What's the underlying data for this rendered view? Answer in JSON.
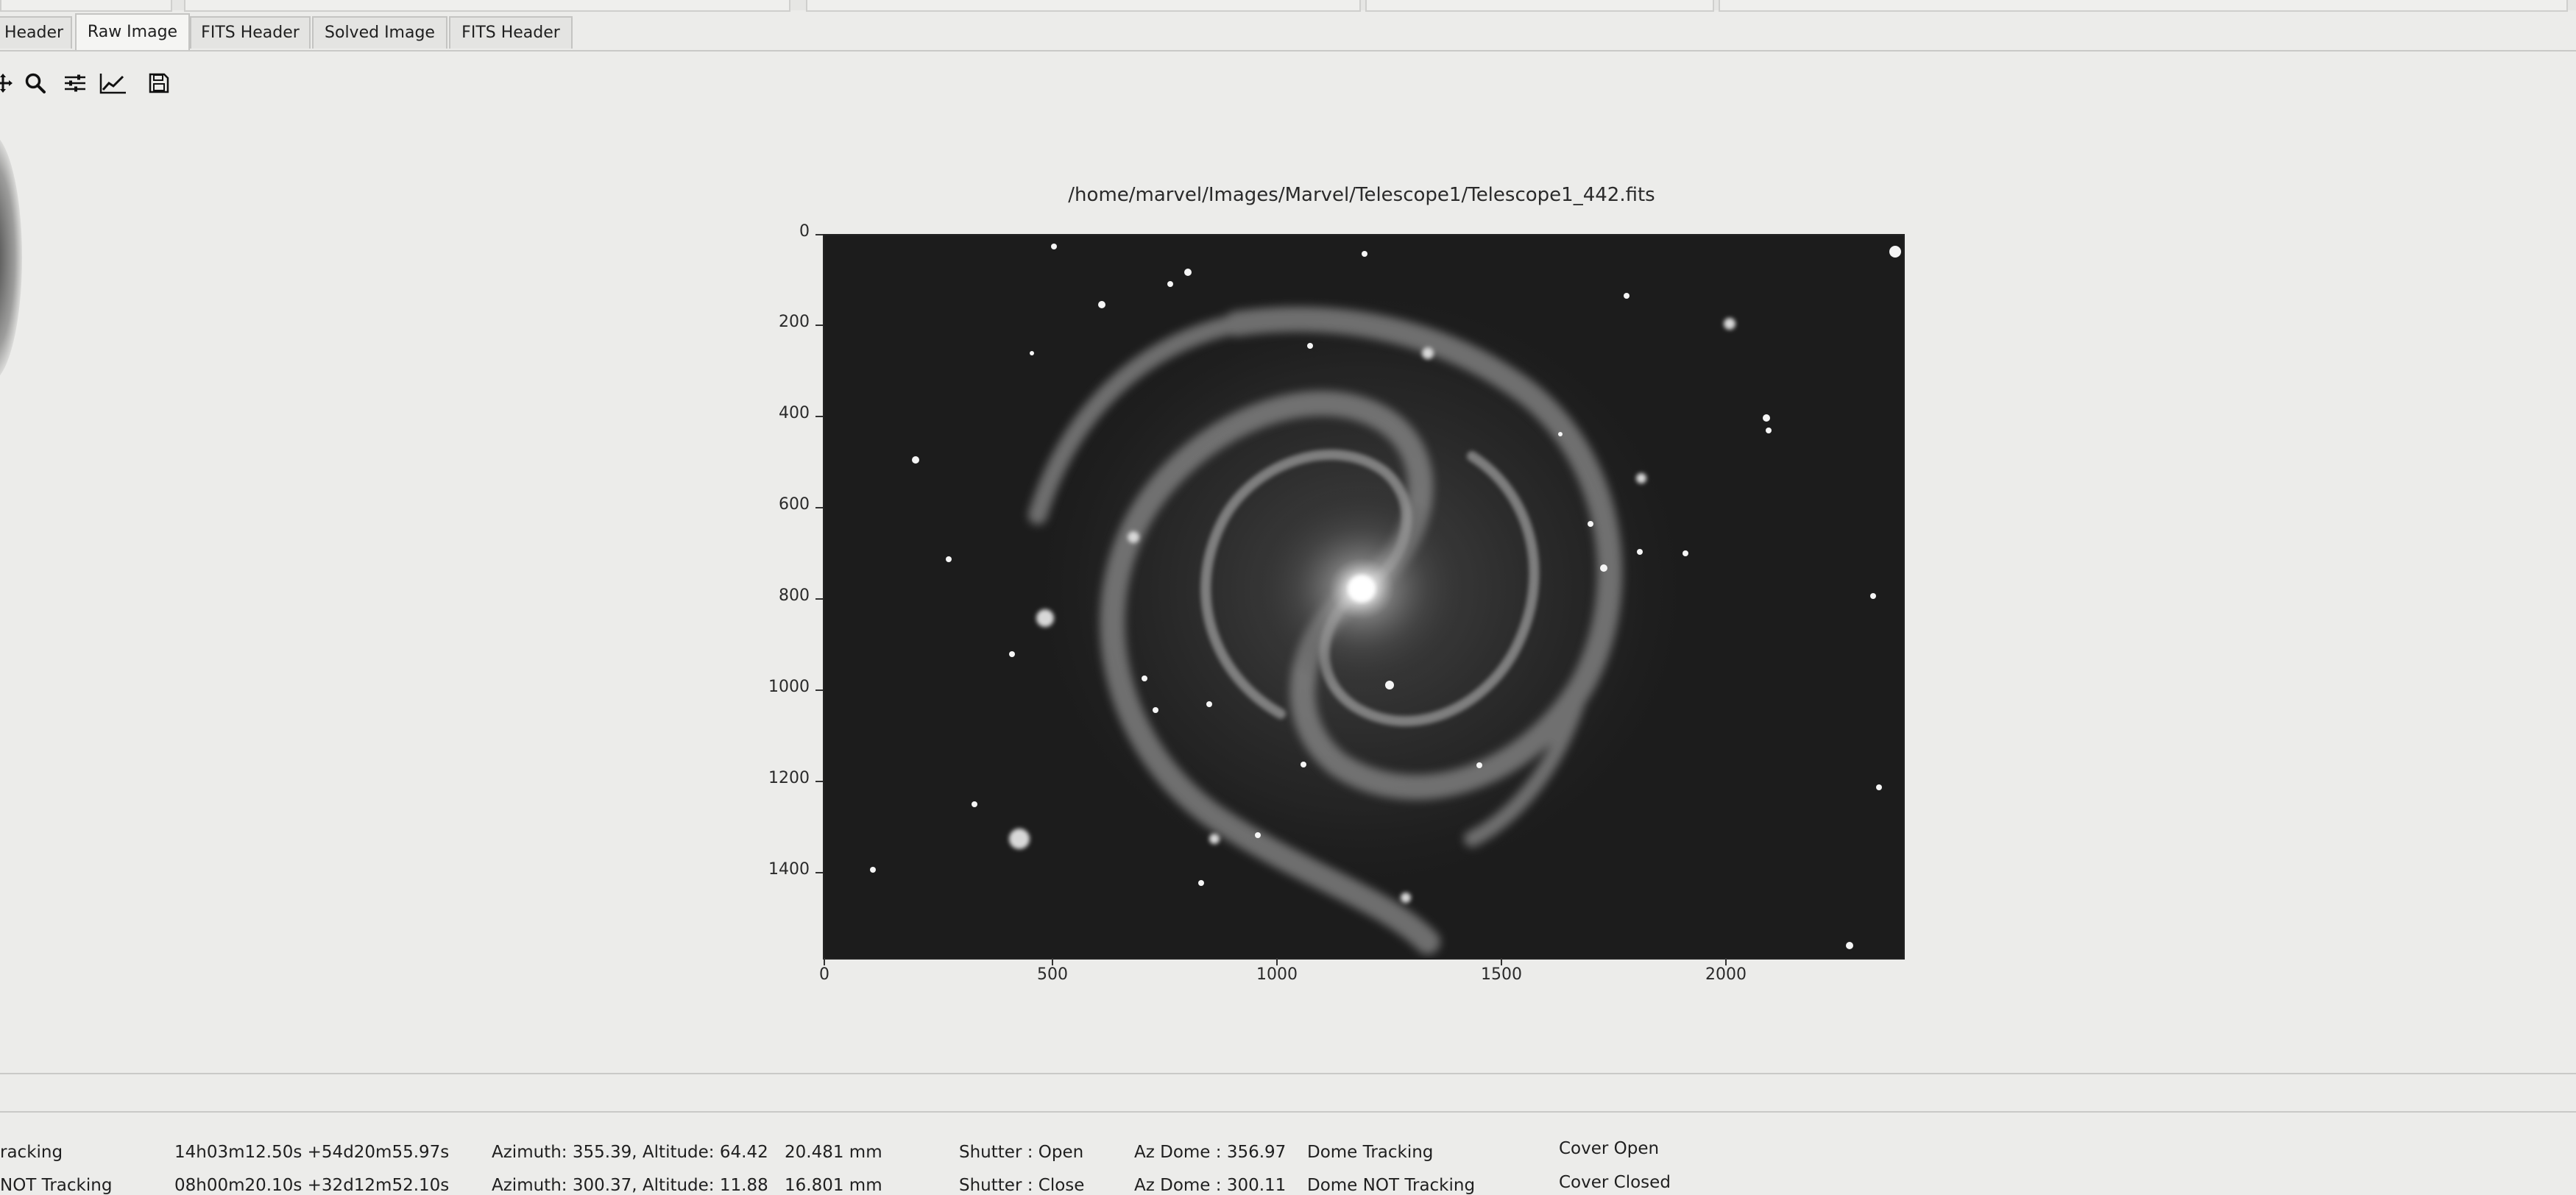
{
  "tabs": [
    {
      "label": "Header",
      "active": false
    },
    {
      "label": "Raw Image",
      "active": true
    },
    {
      "label": "FITS Header",
      "active": false
    },
    {
      "label": "Solved Image",
      "active": false
    },
    {
      "label": "FITS Header",
      "active": false
    }
  ],
  "toolbar": {
    "icons": [
      "move-icon",
      "zoom-icon",
      "sliders-icon",
      "chart-icon",
      "save-icon"
    ]
  },
  "plot": {
    "title": "/home/marvel/Images/Marvel/Telescope1/Telescope1_442.fits",
    "y_ticks": [
      "0",
      "200",
      "400",
      "600",
      "800",
      "1000",
      "1200",
      "1400"
    ],
    "x_ticks": [
      "0",
      "500",
      "1000",
      "1500",
      "2000"
    ],
    "image_subject": "spiral galaxy"
  },
  "status_rows": [
    {
      "tracking": "racking",
      "coords": "14h03m12.50s +54d20m55.97s",
      "azalt": "Azimuth: 355.39, Altitude: 64.42",
      "focus": "20.481 mm",
      "shutter": "Shutter : Open",
      "az_dome": "Az Dome : 356.97",
      "dome_tracking": "Dome Tracking",
      "cover": "Cover Open"
    },
    {
      "tracking": "NOT Tracking",
      "coords": "08h00m20.10s +32d12m52.10s",
      "azalt": "Azimuth: 300.37, Altitude: 11.88",
      "focus": "16.801 mm",
      "shutter": "Shutter : Close",
      "az_dome": "Az Dome : 300.11",
      "dome_tracking": "Dome NOT Tracking",
      "cover": "Cover Closed"
    }
  ]
}
